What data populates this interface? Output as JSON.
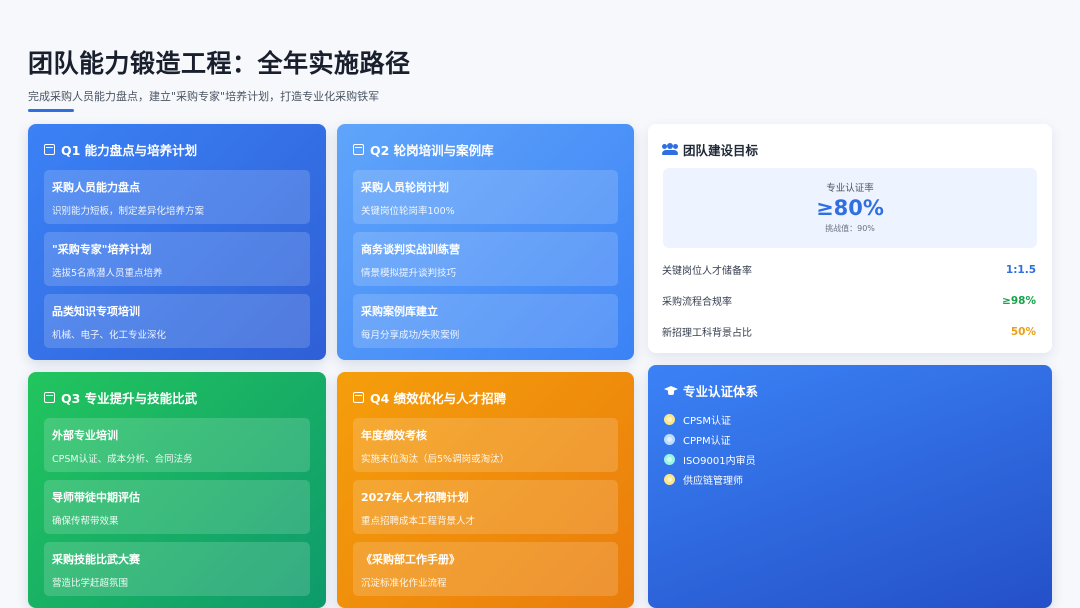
{
  "header": {
    "title": "团队能力锻造工程：全年实施路径",
    "subtitle": "完成采购人员能力盘点，建立\"采购专家\"培养计划，打造专业化采购铁军"
  },
  "quarters": [
    {
      "title": "Q1 能力盘点与培养计划",
      "items": [
        {
          "title": "采购人员能力盘点",
          "desc": "识别能力短板，制定差异化培养方案"
        },
        {
          "title": "\"采购专家\"培养计划",
          "desc": "选拔5名高潜人员重点培养"
        },
        {
          "title": "品类知识专项培训",
          "desc": "机械、电子、化工专业深化"
        }
      ]
    },
    {
      "title": "Q2 轮岗培训与案例库",
      "items": [
        {
          "title": "采购人员轮岗计划",
          "desc": "关键岗位轮岗率100%"
        },
        {
          "title": "商务谈判实战训练营",
          "desc": "情景模拟提升谈判技巧"
        },
        {
          "title": "采购案例库建立",
          "desc": "每月分享成功/失败案例"
        }
      ]
    },
    {
      "title": "Q3 专业提升与技能比武",
      "items": [
        {
          "title": "外部专业培训",
          "desc": "CPSM认证、成本分析、合同法务"
        },
        {
          "title": "导师带徒中期评估",
          "desc": "确保传帮带效果"
        },
        {
          "title": "采购技能比武大赛",
          "desc": "营造比学赶超氛围"
        }
      ]
    },
    {
      "title": "Q4 绩效优化与人才招聘",
      "items": [
        {
          "title": "年度绩效考核",
          "desc": "实施末位淘汰（后5%调岗或淘汰）"
        },
        {
          "title": "2027年人才招聘计划",
          "desc": "重点招聘成本工程背景人才"
        },
        {
          "title": "《采购部工作手册》",
          "desc": "沉淀标准化作业流程"
        }
      ]
    }
  ],
  "goals": {
    "title": "团队建设目标",
    "hero_label": "专业认证率",
    "hero_value": "≥80%",
    "hero_sub": "挑战值：90%",
    "metrics": [
      {
        "label": "关键岗位人才储备率",
        "value": "1:1.5",
        "color": "#2f6fe0"
      },
      {
        "label": "采购流程合规率",
        "value": "≥98%",
        "color": "#16a34a"
      },
      {
        "label": "新招理工科背景占比",
        "value": "50%",
        "color": "#e8a019"
      }
    ]
  },
  "certs": {
    "title": "专业认证体系",
    "items": [
      {
        "label": "CPSM认证",
        "color": "#fde68a"
      },
      {
        "label": "CPPM认证",
        "color": "#bfdbfe"
      },
      {
        "label": "ISO9001内审员",
        "color": "#99f6e4"
      },
      {
        "label": "供应链管理师",
        "color": "#fde68a"
      }
    ]
  }
}
